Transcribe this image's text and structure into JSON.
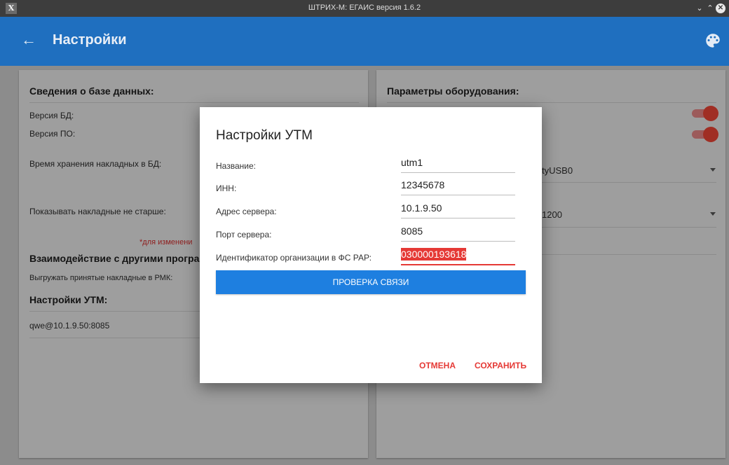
{
  "window": {
    "title": "ШТРИХ-М: ЕГАИС версия 1.6.2",
    "minimize_glyph": "⌄",
    "maximize_glyph": "⌃",
    "close_glyph": "✕"
  },
  "appbar": {
    "back_glyph": "←",
    "title": "Настройки",
    "background": "#1f6fbf"
  },
  "left_panel": {
    "db_section_title": "Сведения о базе данных:",
    "db_version_label": "Версия БД:",
    "app_version_label": "Версия ПО:",
    "storage_time_label": "Время хранения накладных в БД:",
    "show_not_older_label": "Показывать накладные не старше:",
    "change_note": "*для изменени",
    "interaction_title": "Взаимодействие с другими програ",
    "export_label": "Выгружать принятые накладные в РМК:",
    "utm_title": "Настройки УТМ:",
    "utm_entry": "qwe@10.1.9.50:8085"
  },
  "right_panel": {
    "equipment_title": "Параметры оборудования:",
    "port_value": "tyUSB0",
    "baud_value": "1200",
    "toggle1_on": true,
    "toggle2_on": true
  },
  "dialog": {
    "title": "Настройки УТМ",
    "fields": {
      "name": {
        "label": "Название:",
        "value": "utm1"
      },
      "inn": {
        "label": "ИНН:",
        "value": "12345678"
      },
      "address": {
        "label": "Адрес сервера:",
        "value": "10.1.9.50"
      },
      "port": {
        "label": "Порт сервера:",
        "value": "8085"
      },
      "org_id": {
        "label": "Идентификатор организации в ФС РАР:",
        "value": "030000193618"
      }
    },
    "check_button": "ПРОВЕРКА СВЯЗИ",
    "cancel_button": "ОТМЕНА",
    "save_button": "СОХРАНИТЬ",
    "accent_color": "#e53935",
    "button_color": "#1e7fe0"
  }
}
